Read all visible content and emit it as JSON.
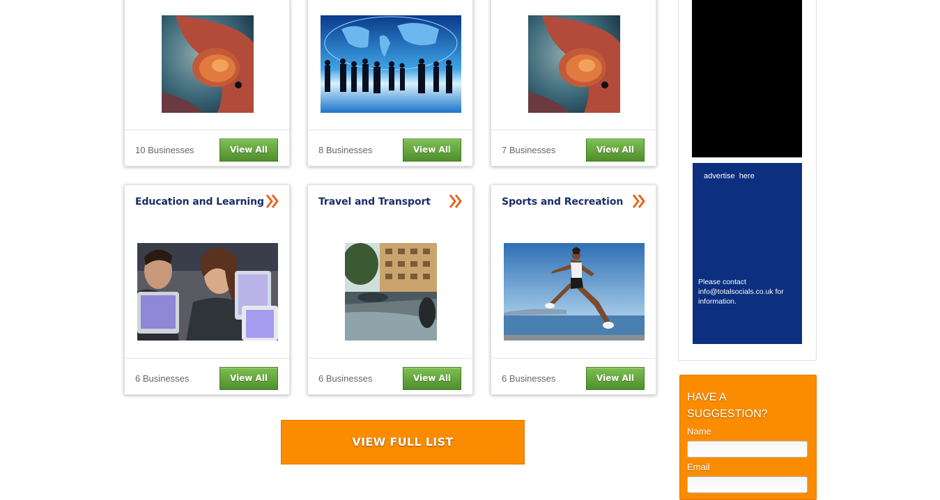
{
  "cards_top": [
    {
      "count": "10 Businesses",
      "button": "View All"
    },
    {
      "count": "8 Businesses",
      "button": "View All"
    },
    {
      "count": "7 Businesses",
      "button": "View All"
    }
  ],
  "cards_bottom": [
    {
      "title": "Education and Learning",
      "count": "6 Businesses",
      "button": "View All"
    },
    {
      "title": "Travel and Transport",
      "count": "6 Businesses",
      "button": "View All"
    },
    {
      "title": "Sports and Recreation",
      "count": "6 Businesses",
      "button": "View All"
    }
  ],
  "view_full_list": "VIEW FULL LIST",
  "sidebar": {
    "ad_title": "advertise here",
    "ad_contact": "Please contact info@totalsocials.co.uk for information."
  },
  "suggestion": {
    "heading": "HAVE A SUGGESTION?",
    "name_label": "Name",
    "email_label": "Email",
    "name_value": "",
    "email_value": ""
  },
  "colors": {
    "title": "#1a2d6b",
    "button_green": "#5a9c35",
    "accent_orange": "#fb8c00",
    "ad_blue": "#0c2f7f",
    "arrow_orange": "#e8621c"
  }
}
